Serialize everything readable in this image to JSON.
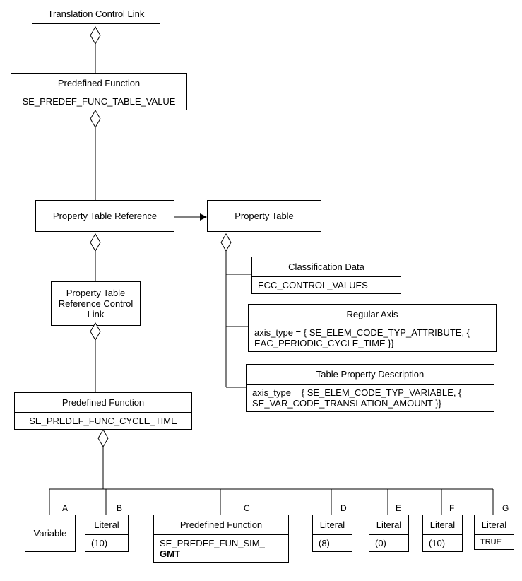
{
  "boxes": {
    "tcl": {
      "title": "Translation Control Link"
    },
    "pf1": {
      "title": "Predefined Function",
      "content": "SE_PREDEF_FUNC_TABLE_VALUE"
    },
    "ptr": {
      "title": "Property Table Reference"
    },
    "pt": {
      "title": "Property Table"
    },
    "ptrcl": {
      "title": "Property Table Reference Control Link"
    },
    "cd": {
      "title": "Classification Data",
      "content": "ECC_CONTROL_VALUES"
    },
    "ra": {
      "title": "Regular Axis",
      "content": "axis_type = { SE_ELEM_CODE_TYP_ATTRIBUTE, { EAC_PERIODIC_CYCLE_TIME }}"
    },
    "tpd": {
      "title": "Table Property Description",
      "content": "axis_type = { SE_ELEM_CODE_TYP_VARIABLE, { SE_VAR_CODE_TRANSLATION_AMOUNT }}"
    },
    "pf2": {
      "title": "Predefined Function",
      "content": "SE_PREDEF_FUNC_CYCLE_TIME"
    },
    "a": {
      "title": "Variable"
    },
    "b": {
      "title": "Literal",
      "content": "(10)"
    },
    "c": {
      "title": "Predefined Function",
      "content1": "SE_PREDEF_FUN_SIM_",
      "content2": "GMT"
    },
    "d": {
      "title": "Literal",
      "content": "(8)"
    },
    "e": {
      "title": "Literal",
      "content": "(0)"
    },
    "f": {
      "title": "Literal",
      "content": "(10)"
    },
    "g": {
      "title": "Literal",
      "content": "TRUE"
    }
  },
  "labels": {
    "a": "A",
    "b": "B",
    "c": "C",
    "d": "D",
    "e": "E",
    "f": "F",
    "g": "G"
  }
}
